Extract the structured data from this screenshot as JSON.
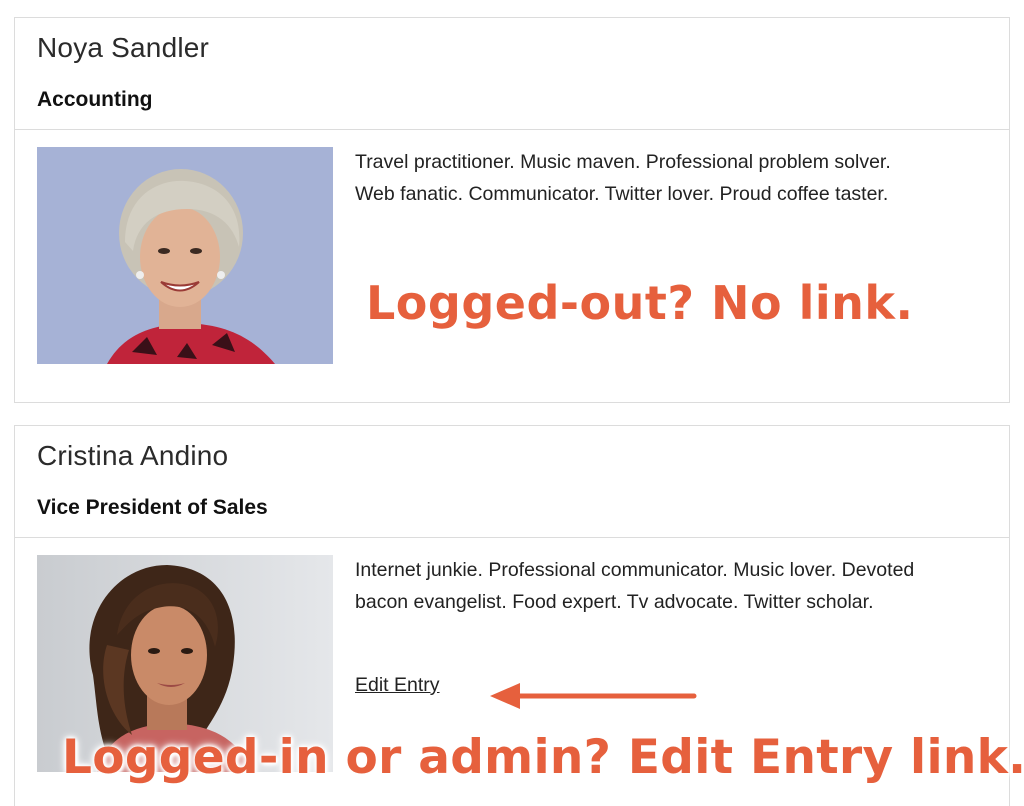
{
  "entries": [
    {
      "name": "Noya Sandler",
      "title": "Accounting",
      "bio": "Travel practitioner. Music maven. Professional problem solver. Web fanatic. Communicator. Twitter lover. Proud coffee taster."
    },
    {
      "name": "Cristina Andino",
      "title": "Vice President of Sales",
      "bio": "Internet junkie. Professional communicator. Music lover. Devoted bacon evangelist. Food expert. Tv advocate. Twitter scholar.",
      "edit_label": "Edit Entry"
    }
  ],
  "annotations": {
    "logged_out": "Logged-out? No link.",
    "logged_in": "Logged-in or admin? Edit Entry link."
  },
  "colors": {
    "accent": "#e6603d",
    "border": "#dcdcdc",
    "photo1_background": "#a6b2d6",
    "photo2_background": "#d7dadd"
  },
  "icons": {
    "arrow": "arrow-left-icon"
  }
}
